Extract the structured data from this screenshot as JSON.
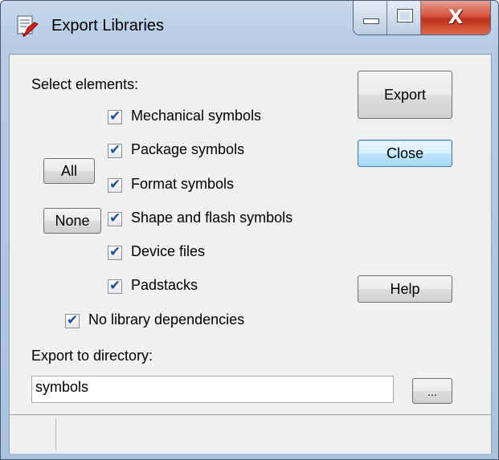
{
  "window": {
    "title": "Export Libraries",
    "close_glyph": "X"
  },
  "dialog": {
    "select_label": "Select elements:",
    "elements": [
      {
        "label": "Mechanical symbols",
        "checked": true
      },
      {
        "label": "Package symbols",
        "checked": true
      },
      {
        "label": "Format symbols",
        "checked": true
      },
      {
        "label": "Shape and flash symbols",
        "checked": true
      },
      {
        "label": "Device files",
        "checked": true
      },
      {
        "label": "Padstacks",
        "checked": true
      }
    ],
    "all_label": "All",
    "none_label": "None",
    "no_deps": {
      "label": "No library dependencies",
      "checked": true
    },
    "export_label": "Export",
    "close_label": "Close",
    "help_label": "Help",
    "dir_label": "Export to directory:",
    "dir_value": "symbols",
    "browse_label": "..."
  },
  "icons": {
    "app": "export-libraries-icon",
    "minimize": "minimize-icon",
    "maximize": "maximize-icon",
    "close": "close-icon"
  },
  "colors": {
    "check": "#1d4f93",
    "close_red": "#c02f1a",
    "focus_blue": "#3c7fb1"
  }
}
